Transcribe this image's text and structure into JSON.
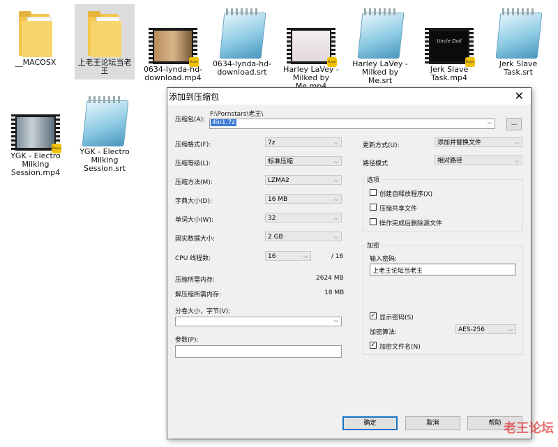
{
  "desktop": {
    "files": [
      {
        "name": "__MACOSX",
        "kind": "folder"
      },
      {
        "name": "上老王论坛当老王",
        "kind": "folder"
      },
      {
        "name": "0634-lynda-hd-download.mp4",
        "kind": "video"
      },
      {
        "name": "0634-lynda-hd-download.srt",
        "kind": "text"
      },
      {
        "name": "Harley LaVey - Milked by Me.mp4",
        "kind": "video"
      },
      {
        "name": "Harley LaVey - Milked by Me.srt",
        "kind": "text"
      },
      {
        "name": "Jerk Slave Task.mp4",
        "kind": "video"
      },
      {
        "name": "Jerk Slave Task.srt",
        "kind": "text"
      },
      {
        "name": "YGK - Electro Milking Session.mp4",
        "kind": "video"
      },
      {
        "name": "YGK - Electro Milking Session.srt",
        "kind": "text"
      }
    ],
    "video_badge": "Player",
    "jerk_thumb_text": "Uncle Doll"
  },
  "dialog": {
    "title": "添加到压缩包",
    "close": "✕",
    "archive_label": "压缩包(A):",
    "archive_path": "F:\\Pornstars\\老王\\",
    "archive_name": "4in1.7z",
    "browse": "...",
    "format_label": "压缩格式(F):",
    "format_value": "7z",
    "level_label": "压缩等级(L):",
    "level_value": "标准压缩",
    "method_label": "压缩方法(M):",
    "method_value": "LZMA2",
    "dict_label": "字典大小(D):",
    "dict_value": "16 MB",
    "word_label": "单词大小(W):",
    "word_value": "32",
    "solid_label": "固实数据大小:",
    "solid_value": "2 GB",
    "cpu_label": "CPU 线程数:",
    "cpu_value": "16",
    "cpu_total": "/ 16",
    "mem_comp_label": "压缩所需内存:",
    "mem_comp_value": "2624 MB",
    "mem_decomp_label": "解压缩所需内存:",
    "mem_decomp_value": "18 MB",
    "split_label": "分卷大小，字节(V):",
    "params_label": "参数(P):",
    "update_label": "更新方式(U):",
    "update_value": "添加并替换文件",
    "pathmode_label": "路径模式",
    "pathmode_value": "相对路径",
    "options_label": "选项",
    "opt_sfx": "创建自释放程序(X)",
    "opt_shared": "压缩共享文件",
    "opt_delete": "操作完成后删除源文件",
    "encrypt_label": "加密",
    "password_label": "输入密码:",
    "password_value": "上老王论坛当老王",
    "show_password": "显示密码(S)",
    "enc_method_label": "加密算法:",
    "enc_method_value": "AES-256",
    "encrypt_names": "加密文件名(N)",
    "ok": "确定",
    "cancel": "取消",
    "help": "帮助"
  },
  "watermark": "老王论坛"
}
